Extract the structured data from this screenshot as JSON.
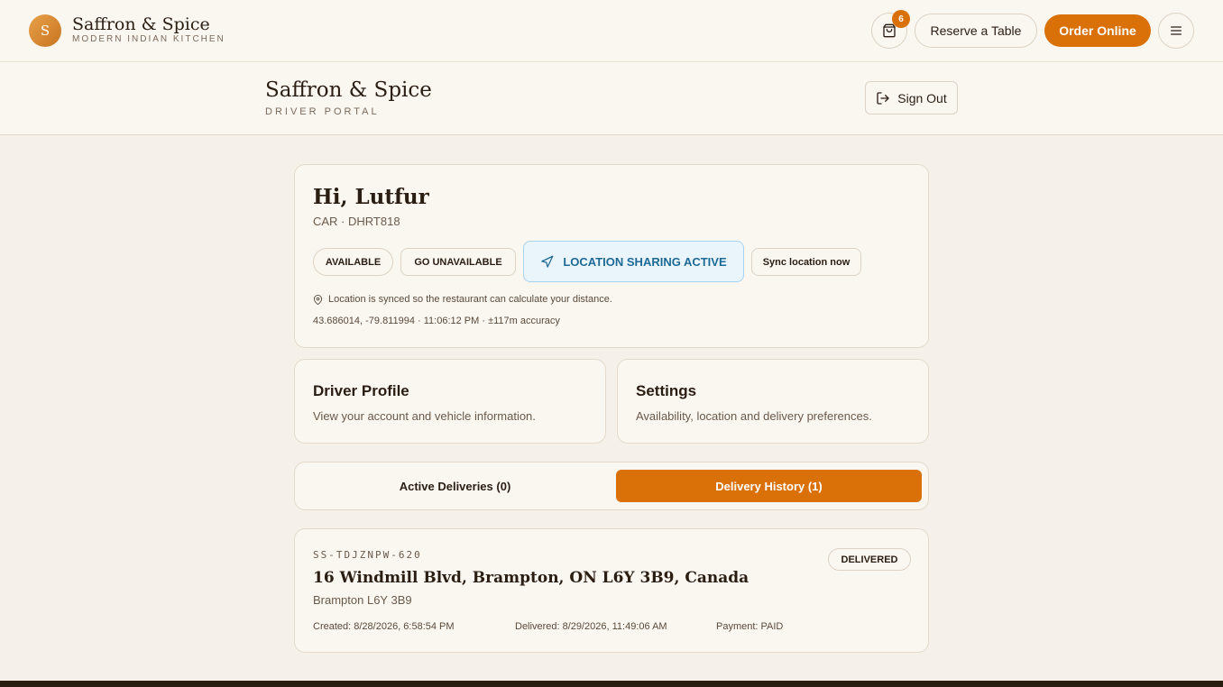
{
  "nav": {
    "logo_letter": "S",
    "brand_name": "Saffron & Spice",
    "brand_sub": "MODERN INDIAN KITCHEN",
    "cart_count": "6",
    "reserve_label": "Reserve a Table",
    "order_label": "Order Online"
  },
  "portal": {
    "title": "Saffron & Spice",
    "subtitle": "DRIVER PORTAL",
    "signout_label": "Sign Out"
  },
  "driver": {
    "greeting": "Hi, Lutfur",
    "vehicle": "CAR · DHRT818",
    "btn_available": "AVAILABLE",
    "btn_unavailable": "GO UNAVAILABLE",
    "btn_location": "LOCATION SHARING ACTIVE",
    "btn_sync": "Sync location now",
    "location_note": "Location is synced so the restaurant can calculate your distance.",
    "coords": "43.686014, -79.811994 · 11:06:12 PM · ±117m accuracy"
  },
  "profile": {
    "title": "Driver Profile",
    "desc": "View your account and vehicle information."
  },
  "settings": {
    "title": "Settings",
    "desc": "Availability, location and delivery preferences."
  },
  "tabs": {
    "active": "Active Deliveries (0)",
    "history": "Delivery History (1)"
  },
  "delivery": {
    "order_id": "SS-TDJZNPW-620",
    "address": "16 Windmill Blvd, Brampton, ON L6Y 3B9, Canada",
    "city": "Brampton L6Y 3B9",
    "status": "DELIVERED",
    "created": "Created: 8/28/2026, 6:58:54 PM",
    "delivered": "Delivered: 8/29/2026, 11:49:06 AM",
    "payment": "Payment: PAID"
  },
  "colors": {
    "accent": "#d97008",
    "location_blue": "#1d6a97",
    "background": "#f5f1ea"
  }
}
